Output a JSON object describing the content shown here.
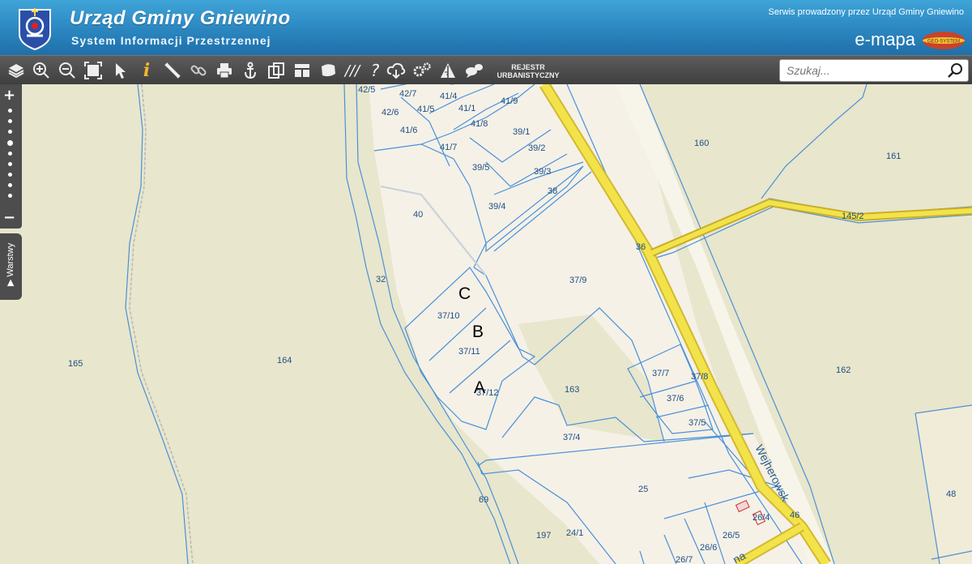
{
  "header": {
    "title": "Urząd Gminy Gniewino",
    "subtitle": "System Informacji Przestrzennej",
    "service_note": "Serwis prowadzony przez Urząd Gminy Gniewino",
    "brand": "e-mapa",
    "brand_badge": "GEO-SYSTEM"
  },
  "toolbar": {
    "tools": [
      "layers-icon",
      "zoom-in-icon",
      "zoom-out-icon",
      "zoom-extent-icon",
      "pointer-icon",
      "info-icon",
      "measure-icon",
      "link-icon",
      "print-icon",
      "anchor-icon",
      "compare-icon",
      "layout-icon",
      "shape-icon",
      "hatch-icon",
      "help-icon",
      "cloud-download-icon",
      "settings-icon",
      "sign-icon",
      "comments-icon"
    ],
    "rejestr_line1": "REJESTR",
    "rejestr_line2": "URBANISTYCZNY"
  },
  "search": {
    "placeholder": "Szukaj..."
  },
  "side": {
    "zoom_in": "+",
    "zoom_out": "−",
    "layers_tab": "Warstwy"
  },
  "map": {
    "parcel_labels": [
      "42/5",
      "42/7",
      "42/6",
      "41/4",
      "41/5",
      "41/1",
      "41/9",
      "41/6",
      "41/8",
      "39/1",
      "41/7",
      "39/2",
      "39/5",
      "39/3",
      "38",
      "40",
      "39/4",
      "160",
      "161",
      "145/2",
      "36",
      "32",
      "37/9",
      "37/10",
      "37/11",
      "37/12",
      "165",
      "164",
      "163",
      "162",
      "37/7",
      "37/8",
      "37/6",
      "37/5",
      "37/4",
      "25",
      "48",
      "69",
      "26/4",
      "46",
      "26/5",
      "197",
      "24/1",
      "26/6",
      "26/7"
    ],
    "markers": [
      "C",
      "B",
      "A"
    ],
    "street": "Wejherowsk",
    "street2": "na"
  },
  "colors": {
    "header_blue": "#2b86c0",
    "toolbar": "#4a4a4a",
    "road_yellow": "#f2e34a",
    "parcel_line": "#4a90d9",
    "meadow": "#e8e6cc",
    "built": "#f5f1e7"
  }
}
